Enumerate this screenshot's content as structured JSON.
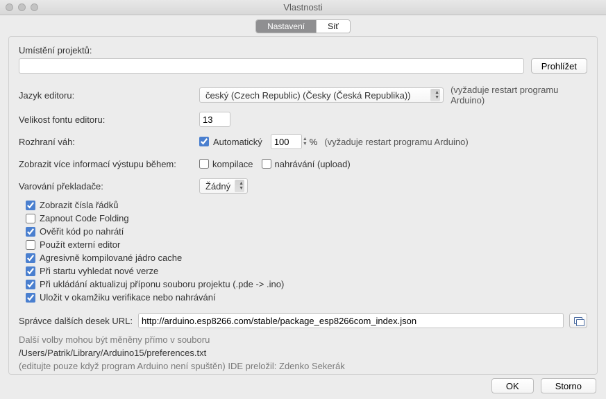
{
  "window": {
    "title": "Vlastnosti"
  },
  "tabs": {
    "settings": "Nastavení",
    "network": "Síť"
  },
  "labels": {
    "sketchbook": "Umístění projektů:",
    "browse": "Prohlížet",
    "editor_lang": "Jazyk editoru:",
    "font_size": "Velikost fontu editoru:",
    "scale": "Rozhraní váh:",
    "verbose": "Zobrazit více informací výstupu během:",
    "warnings": "Varování překladače:",
    "boards_url": "Správce dalších desek URL:",
    "restart_note": "(vyžaduje restart programu Arduino)",
    "restart_note2": "(vyžaduje restart programu Arduino)",
    "percent": "%"
  },
  "values": {
    "sketchbook_path": "",
    "selected_lang": "český (Czech Republic) (Česky (Česká Republika))",
    "font_size": "13",
    "scale_auto_checked": true,
    "scale_auto_label": "Automatický",
    "scale_value": "100",
    "compile_label": "kompilace",
    "upload_label": "nahrávání (upload)",
    "compile_checked": false,
    "upload_checked": false,
    "warnings_selected": "Žádný",
    "boards_url_value": "http://arduino.esp8266.com/stable/package_esp8266com_index.json"
  },
  "checkboxes": [
    {
      "label": "Zobrazit čísla řádků",
      "checked": true
    },
    {
      "label": "Zapnout Code Folding",
      "checked": false
    },
    {
      "label": "Ověřit kód po nahrátí",
      "checked": true
    },
    {
      "label": "Použít externí editor",
      "checked": false
    },
    {
      "label": "Agresivně kompilované jádro cache",
      "checked": true
    },
    {
      "label": "Při startu vyhledat nové verze",
      "checked": true
    },
    {
      "label": "Při ukládání aktualizuj příponu souboru projektu (.pde -> .ino)",
      "checked": true
    },
    {
      "label": "Uložit v okamžiku verifikace nebo nahrávání",
      "checked": true
    }
  ],
  "footer_text": {
    "line1": "Další volby mohou být měněny přímo v souboru",
    "path": "/Users/Patrik/Library/Arduino15/preferences.txt",
    "line2": "(editujte pouze když program Arduino není spuštěn) IDE preložil: Zdenko Sekerák"
  },
  "buttons": {
    "ok": "OK",
    "cancel": "Storno"
  }
}
